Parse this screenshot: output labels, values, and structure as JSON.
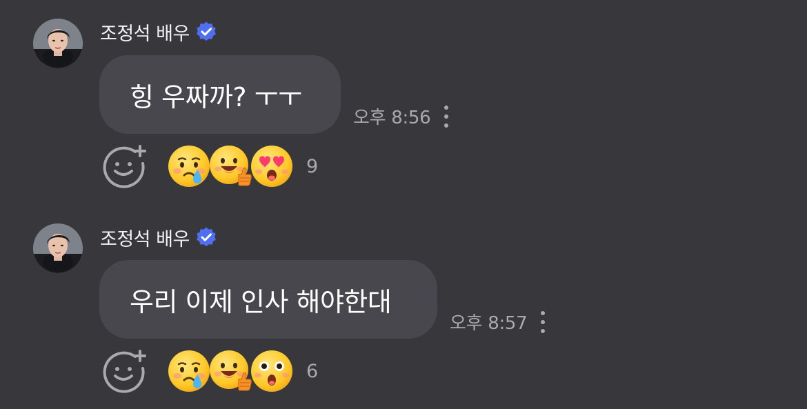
{
  "colors": {
    "background": "#38373c",
    "bubble": "#48474d",
    "verified_badge": "#4f6ff0",
    "muted_text": "#a9a9ae"
  },
  "messages": [
    {
      "sender": "조정석 배우",
      "text": "힝 우짜까? ㅜㅜ",
      "timestamp": "오후 8:56",
      "reactions": [
        "crying-face",
        "thumbs-up-face",
        "heart-eyes-face"
      ],
      "reaction_count": "9"
    },
    {
      "sender": "조정석 배우",
      "text": "우리 이제 인사 해야한대",
      "timestamp": "오후 8:57",
      "reactions": [
        "crying-face",
        "thumbs-up-face",
        "surprised-face"
      ],
      "reaction_count": "6"
    }
  ]
}
